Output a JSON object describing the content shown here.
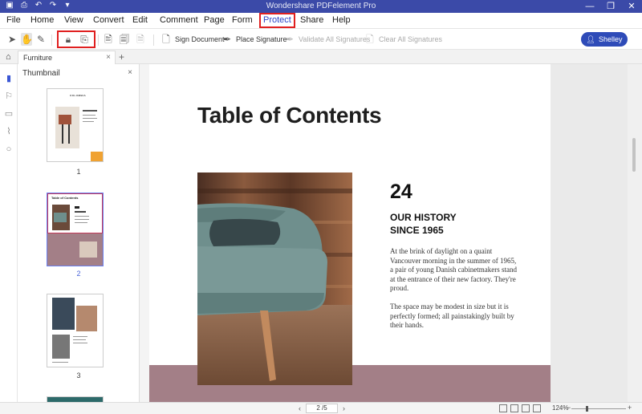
{
  "titlebar": {
    "title": "Wondershare PDFelement Pro",
    "quick_icons": [
      "pdf-icon",
      "print-icon",
      "undo-icon",
      "redo-icon",
      "dropdown-icon"
    ],
    "window_controls": {
      "minimize": "—",
      "restore": "❐",
      "close": "✕"
    }
  },
  "menu": {
    "items": [
      "File",
      "Home",
      "View",
      "Convert",
      "Edit",
      "Comment",
      "Page",
      "Form",
      "Protect",
      "Share",
      "Help"
    ],
    "active": "Protect"
  },
  "toolbar": {
    "sign_document": "Sign Document",
    "place_signature": "Place Signature",
    "validate_all": "Validate All Signatures",
    "clear_all": "Clear All Signatures",
    "user": "Shelley",
    "highlight_color": "#e02020"
  },
  "tabs": {
    "doc_tab": "Furniture",
    "close": "×",
    "add": "+"
  },
  "thumbnail_panel": {
    "title": "Thumbnail",
    "close": "×",
    "pages": [
      {
        "label": "1",
        "thumb_title": "COLUMBIA"
      },
      {
        "label": "2",
        "thumb_title": "Table of Contents"
      },
      {
        "label": "3",
        "thumb_title": ""
      }
    ],
    "selected": "2"
  },
  "document": {
    "heading": "Table of Contents",
    "number": "24",
    "subheading_line1": "OUR HISTORY",
    "subheading_line2": "SINCE 1965",
    "paragraph1": "At the brink of daylight on a quaint Vancouver morning in the summer of 1965, a pair of young Danish cabinetmakers stand at the entrance of their new factory. They're proud.",
    "paragraph2": "The space may be modest in size but it is perfectly formed; all painstakingly built by their hands.",
    "accent_color": "#a37f87"
  },
  "statusbar": {
    "page_box": "2 /5",
    "zoom": "124%",
    "prev": "‹",
    "next": "›",
    "zoom_minus": "−",
    "zoom_plus": "+"
  }
}
